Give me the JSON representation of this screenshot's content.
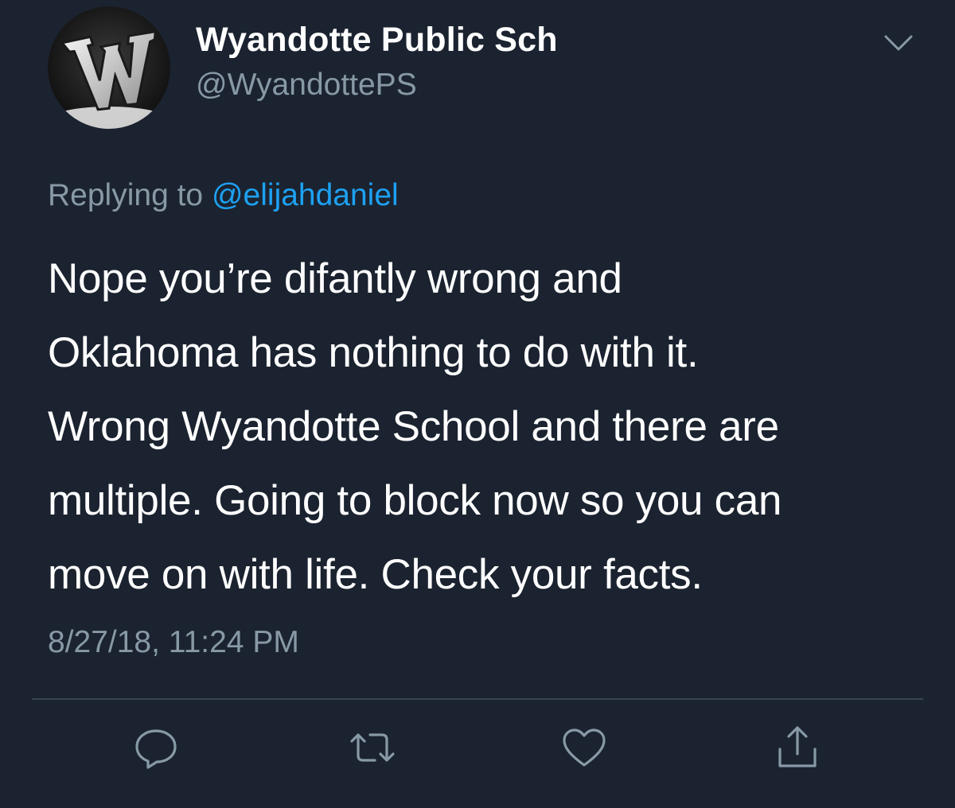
{
  "author": {
    "display_name": "Wyandotte Public Sch",
    "handle": "@WyandottePS",
    "avatar_icon": "wyandotte-w-logo"
  },
  "reply": {
    "prefix": "Replying to ",
    "mention": "@elijahdaniel"
  },
  "tweet": {
    "text": "Nope you’re difantly wrong and\nOklahoma has nothing to do with it.\nWrong Wyandotte School and there are\nmultiple.  Going to block now so you can\nmove on with life. Check your facts.",
    "timestamp": "8/27/18, 11:24 PM"
  },
  "actions": [
    {
      "name": "reply",
      "icon": "speech-bubble-icon"
    },
    {
      "name": "retweet",
      "icon": "retweet-icon"
    },
    {
      "name": "like",
      "icon": "heart-icon"
    },
    {
      "name": "share",
      "icon": "share-icon"
    }
  ],
  "colors": {
    "background": "#1b2330",
    "primary_text": "#ffffff",
    "secondary_text": "#8899a6",
    "link": "#1da1f2",
    "divider": "#38444d"
  }
}
